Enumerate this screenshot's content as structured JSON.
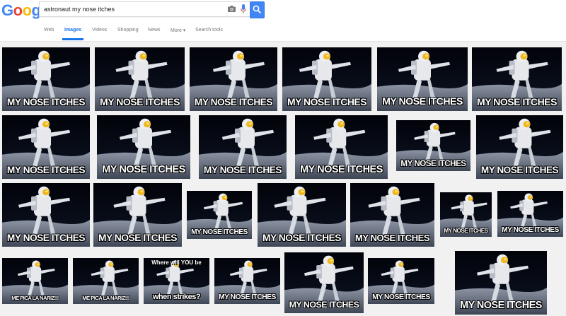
{
  "logo": {
    "text": "Google",
    "letters": [
      "G",
      "o",
      "o",
      "g",
      "l",
      "e"
    ],
    "colors": [
      "#4285f4",
      "#ea4335",
      "#fbbc05",
      "#4285f4",
      "#34a853",
      "#ea4335"
    ]
  },
  "search": {
    "query": "astronaut my nose itches"
  },
  "tabs": [
    {
      "label": "Web",
      "active": false
    },
    {
      "label": "Images",
      "active": true
    },
    {
      "label": "Videos",
      "active": false
    },
    {
      "label": "Shopping",
      "active": false
    },
    {
      "label": "News",
      "active": false
    },
    {
      "label": "More ▾",
      "active": false
    },
    {
      "label": "Search tools",
      "active": false
    }
  ],
  "accent_color": "#4285f4",
  "results": [
    {
      "caption": "MY NOSE ITCHES"
    },
    {
      "caption": "MY NOSE ITCHES"
    },
    {
      "caption": "MY NOSE ITCHES"
    },
    {
      "caption": "MY NOSE ITCHES"
    },
    {
      "caption": "MY NOSE ITCHES"
    },
    {
      "caption": "MY NOSE ITCHES"
    },
    {
      "caption": "MY NOSE ITCHES"
    },
    {
      "caption": "MY NOSE ITCHES"
    },
    {
      "caption": "MY NOSE ITCHES"
    },
    {
      "caption": "MY NOSE ITCHES"
    },
    {
      "caption": "MY NOSE ITCHES"
    },
    {
      "caption": "MY NOSE ITCHES"
    },
    {
      "caption": "MY NOSE ITCHES"
    },
    {
      "caption": "MY NOSE ITCHES"
    },
    {
      "caption": "MY NOSE ITCHES"
    },
    {
      "caption": "MY NOSE ITCHES"
    },
    {
      "caption": "MY NOSE ITCHES"
    },
    {
      "caption": "MY NOSE ITCHES"
    },
    {
      "caption": "MY NOSE ITCHES"
    },
    {
      "caption": "ME PICA LA NARIZ!!!"
    },
    {
      "caption": "ME PICA LA NARIZ!!!"
    },
    {
      "caption": "when strikes?",
      "top_caption": "Where will YOU be"
    },
    {
      "caption": "MY NOSE ITCHES"
    },
    {
      "caption": "MY NOSE ITCHES"
    },
    {
      "caption": "MY NOSE ITCHES"
    },
    {
      "caption": "MY NOSE ITCHES"
    }
  ]
}
